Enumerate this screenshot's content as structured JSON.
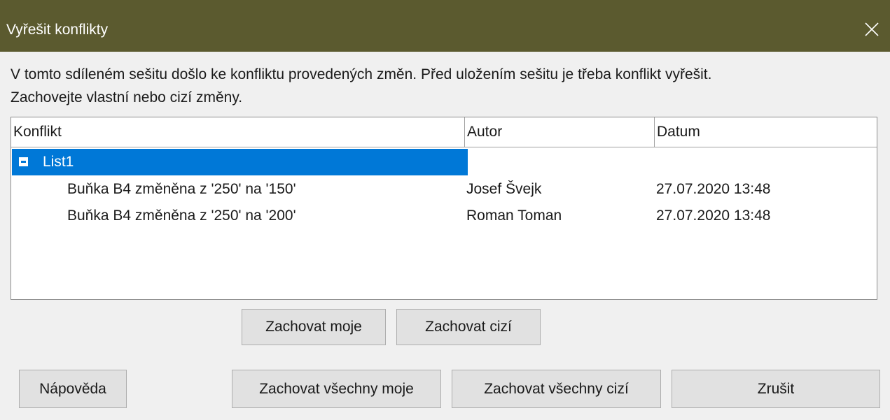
{
  "dialog": {
    "title": "Vyřešit konflikty",
    "close_glyph": "✕",
    "message_line1": "V tomto sdíleném sešitu došlo ke konfliktu provedených změn. Před uložením sešitu je třeba konflikt vyřešit.",
    "message_line2": "Zachovejte vlastní nebo cizí změny."
  },
  "table": {
    "columns": [
      "Konflikt",
      "Autor",
      "Datum"
    ],
    "group": {
      "label": "List1",
      "expanded": true,
      "selected": true
    },
    "rows": [
      {
        "conflict": "Buňka B4 změněna z '250' na '150'",
        "author": "Josef Švejk",
        "date": "27.07.2020 13:48"
      },
      {
        "conflict": "Buňka B4 změněna z '250' na '200'",
        "author": "Roman Toman",
        "date": "27.07.2020 13:48"
      }
    ]
  },
  "buttons": {
    "keep_mine": "Zachovat moje",
    "keep_others": "Zachovat cizí",
    "help": "Nápověda",
    "keep_all_mine": "Zachovat všechny moje",
    "keep_all_others": "Zachovat všechny cizí",
    "cancel": "Zrušit"
  },
  "colors": {
    "titlebar": "#5b5a2f",
    "selection": "#0078d7",
    "button_face": "#e1e1e1"
  }
}
